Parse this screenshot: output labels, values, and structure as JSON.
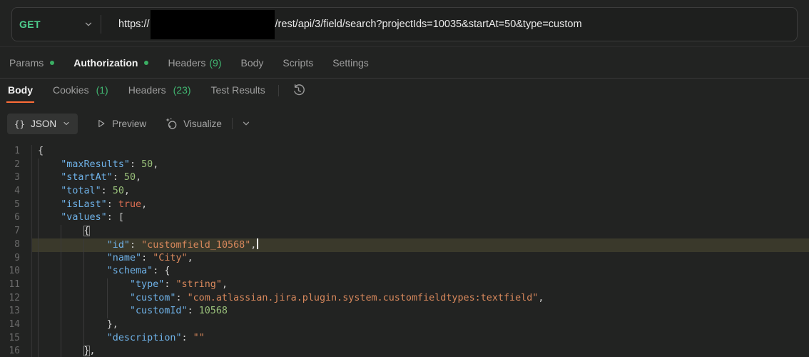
{
  "request": {
    "method": "GET",
    "url_prefix": "https://",
    "url_path": "/rest/api/3/field/search?projectIds=10035&startAt=50&type=custom",
    "tabs": [
      {
        "label": "Params",
        "dot": true
      },
      {
        "label": "Authorization",
        "dot": true,
        "active": true
      },
      {
        "label": "Headers",
        "count": "(9)"
      },
      {
        "label": "Body"
      },
      {
        "label": "Scripts"
      },
      {
        "label": "Settings"
      }
    ]
  },
  "response": {
    "tabs": [
      {
        "label": "Body",
        "active": true
      },
      {
        "label": "Cookies",
        "count": "(1)"
      },
      {
        "label": "Headers",
        "count": "(23)"
      },
      {
        "label": "Test Results"
      }
    ],
    "toolbar": {
      "format_icon": "{}",
      "format_label": "JSON",
      "preview_label": "Preview",
      "visualize_label": "Visualize"
    }
  },
  "editor": {
    "lines": [
      {
        "n": 1,
        "g": 0,
        "t": [
          [
            "p",
            "{"
          ]
        ]
      },
      {
        "n": 2,
        "g": 1,
        "t": [
          [
            "k",
            "\"maxResults\""
          ],
          [
            "p",
            ": "
          ],
          [
            "n",
            "50"
          ],
          [
            "p",
            ","
          ]
        ]
      },
      {
        "n": 3,
        "g": 1,
        "t": [
          [
            "k",
            "\"startAt\""
          ],
          [
            "p",
            ": "
          ],
          [
            "n",
            "50"
          ],
          [
            "p",
            ","
          ]
        ]
      },
      {
        "n": 4,
        "g": 1,
        "t": [
          [
            "k",
            "\"total\""
          ],
          [
            "p",
            ": "
          ],
          [
            "n",
            "50"
          ],
          [
            "p",
            ","
          ]
        ]
      },
      {
        "n": 5,
        "g": 1,
        "t": [
          [
            "k",
            "\"isLast\""
          ],
          [
            "p",
            ": "
          ],
          [
            "b",
            "true"
          ],
          [
            "p",
            ","
          ]
        ]
      },
      {
        "n": 6,
        "g": 1,
        "t": [
          [
            "k",
            "\"values\""
          ],
          [
            "p",
            ": ["
          ]
        ]
      },
      {
        "n": 7,
        "g": 2,
        "t": [
          [
            "m",
            "{"
          ]
        ]
      },
      {
        "n": 8,
        "g": 3,
        "hl": true,
        "t": [
          [
            "k",
            "\"id\""
          ],
          [
            "p",
            ": "
          ],
          [
            "s",
            "\"customfield_10568\""
          ],
          [
            "p",
            ","
          ],
          [
            "c",
            ""
          ]
        ]
      },
      {
        "n": 9,
        "g": 3,
        "t": [
          [
            "k",
            "\"name\""
          ],
          [
            "p",
            ": "
          ],
          [
            "s",
            "\"City\""
          ],
          [
            "p",
            ","
          ]
        ]
      },
      {
        "n": 10,
        "g": 3,
        "t": [
          [
            "k",
            "\"schema\""
          ],
          [
            "p",
            ": {"
          ]
        ]
      },
      {
        "n": 11,
        "g": 4,
        "t": [
          [
            "k",
            "\"type\""
          ],
          [
            "p",
            ": "
          ],
          [
            "s",
            "\"string\""
          ],
          [
            "p",
            ","
          ]
        ]
      },
      {
        "n": 12,
        "g": 4,
        "t": [
          [
            "k",
            "\"custom\""
          ],
          [
            "p",
            ": "
          ],
          [
            "s",
            "\"com.atlassian.jira.plugin.system.customfieldtypes:textfield\""
          ],
          [
            "p",
            ","
          ]
        ]
      },
      {
        "n": 13,
        "g": 4,
        "t": [
          [
            "k",
            "\"customId\""
          ],
          [
            "p",
            ": "
          ],
          [
            "n",
            "10568"
          ]
        ]
      },
      {
        "n": 14,
        "g": 3,
        "t": [
          [
            "p",
            "},"
          ]
        ]
      },
      {
        "n": 15,
        "g": 3,
        "t": [
          [
            "k",
            "\"description\""
          ],
          [
            "p",
            ": "
          ],
          [
            "s",
            "\"\""
          ]
        ]
      },
      {
        "n": 16,
        "g": 2,
        "t": [
          [
            "m",
            "}"
          ],
          [
            "p",
            ","
          ]
        ]
      }
    ]
  },
  "colors": {
    "method_get_green": "#4ECE8D",
    "count_green": "#41B671",
    "unsaved_dot_green": "#3AAE63",
    "active_tab_underline_orange": "#FF6C37",
    "token_key": "#6FB2E8",
    "token_string": "#D8885C",
    "token_number": "#99C07A",
    "token_boolean": "#DF6F53",
    "line_highlight": "#3A392B",
    "background": "#222322"
  }
}
